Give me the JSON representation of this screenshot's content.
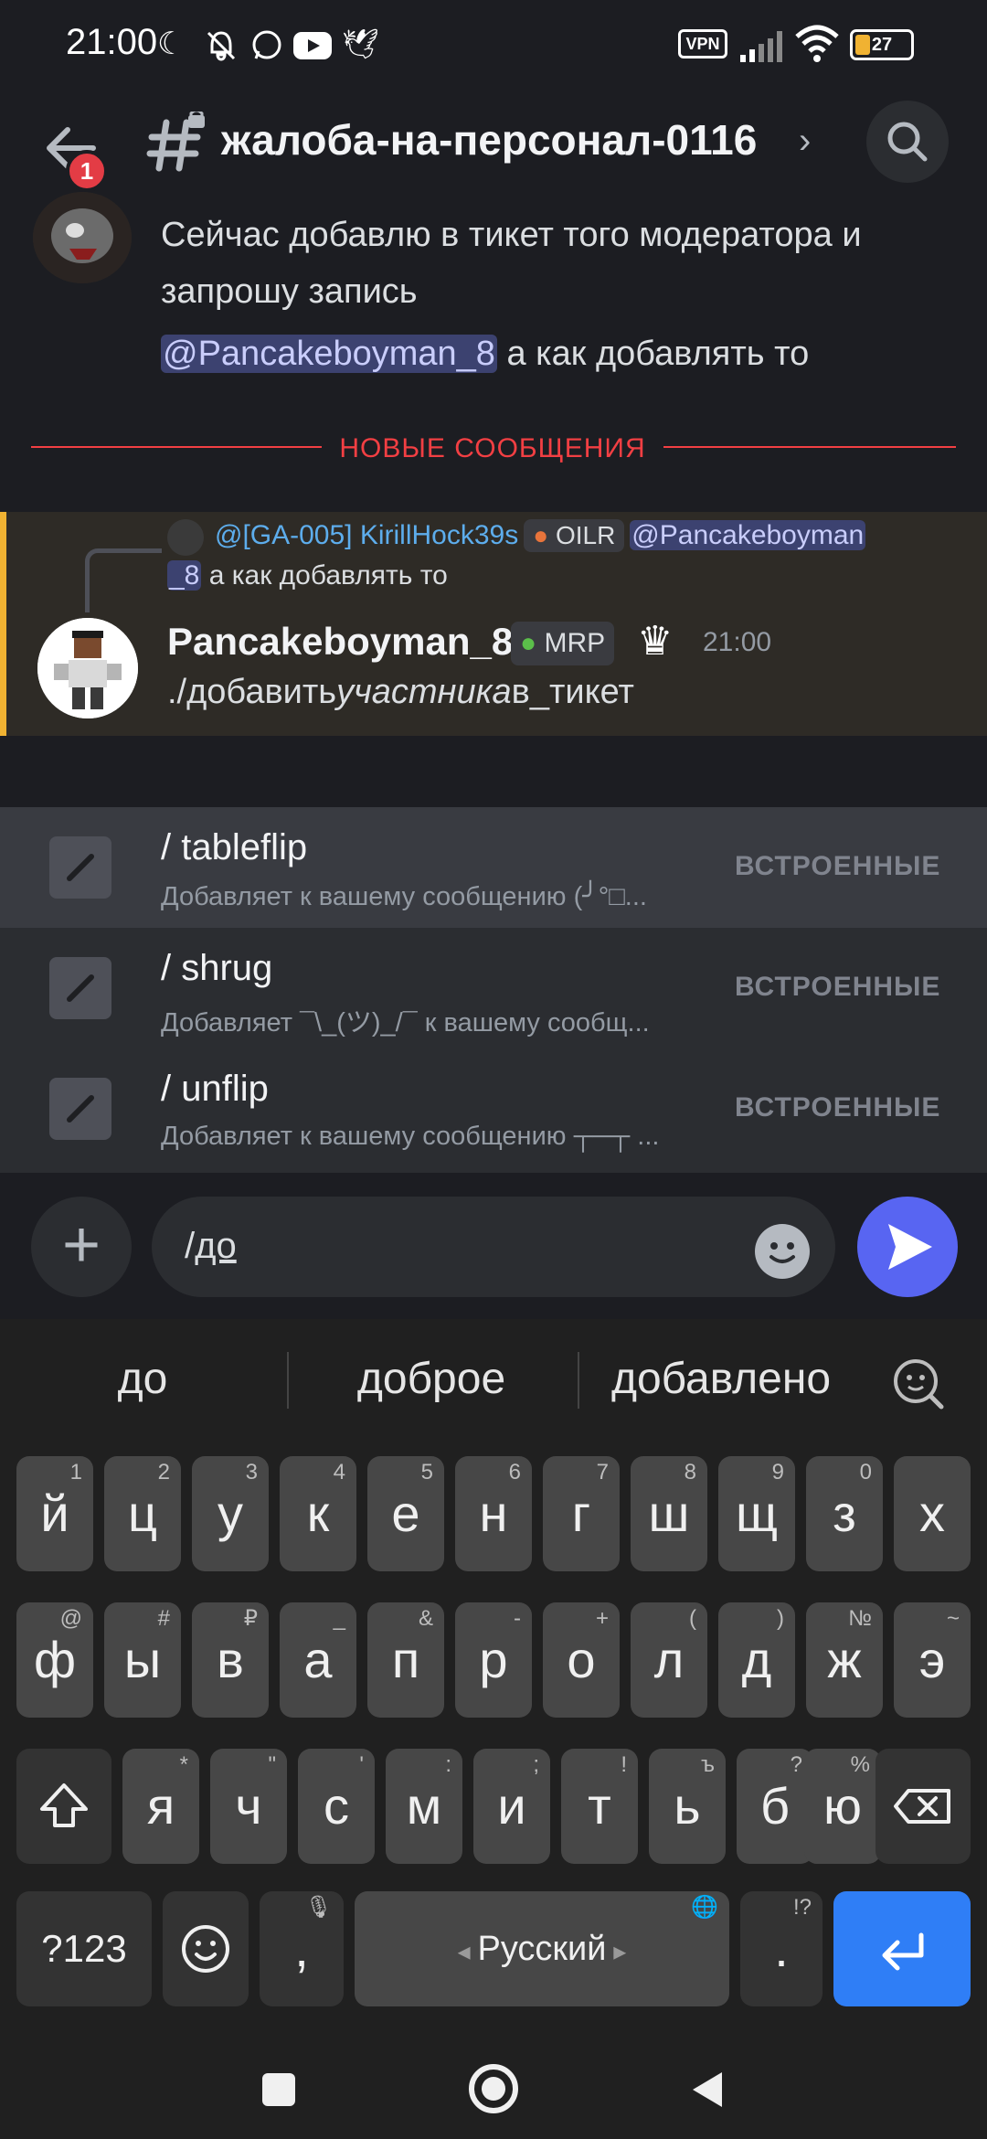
{
  "status_bar": {
    "time": "21:00",
    "vpn_label": "VPN",
    "battery": "27"
  },
  "header": {
    "unread_badge": "1",
    "channel_name": "жалоба-на-персонал-0116"
  },
  "messages": {
    "prev_line1": "Сейчас добавлю в тикет того модератора и",
    "prev_line2": "запрошу запись",
    "prev_mention": "@Pancakeboyman_8",
    "prev_line3_rest": " а как добавлять то",
    "new_messages_label": "НОВЫЕ СООБЩЕНИЯ",
    "reply_author": "@[GA-005] KirillHock39s",
    "reply_role": "OILR",
    "reply_mention_part1": "@Pancakeboyman",
    "reply_mention_part2": "_8",
    "reply_text": " а как добавлять то",
    "author": "Pancakeboyman_8",
    "author_role": "MRP",
    "timestamp": "21:00",
    "body_prefix": "./добавить",
    "body_italic": "участника",
    "body_suffix": "в_тикет"
  },
  "commands": [
    {
      "name": "/ tableflip",
      "description": "Добавляет к вашему сообщению (╯°□...",
      "source": "ВСТРОЕННЫЕ"
    },
    {
      "name": "/ shrug",
      "description": "Добавляет ¯\\_(ツ)_/¯ к вашему сообщ...",
      "source": "ВСТРОЕННЫЕ"
    },
    {
      "name": "/ unflip",
      "description": "Добавляет к вашему сообщению ┬─┬ ...",
      "source": "ВСТРОЕННЫЕ"
    }
  ],
  "composer": {
    "slash": "/",
    "typed": "до"
  },
  "keyboard": {
    "suggestions": [
      "до",
      "доброе",
      "добавлено"
    ],
    "row1": [
      {
        "k": "й",
        "h": "1"
      },
      {
        "k": "ц",
        "h": "2"
      },
      {
        "k": "у",
        "h": "3"
      },
      {
        "k": "к",
        "h": "4"
      },
      {
        "k": "е",
        "h": "5"
      },
      {
        "k": "н",
        "h": "6"
      },
      {
        "k": "г",
        "h": "7"
      },
      {
        "k": "ш",
        "h": "8"
      },
      {
        "k": "щ",
        "h": "9"
      },
      {
        "k": "з",
        "h": "0"
      },
      {
        "k": "х",
        "h": ""
      }
    ],
    "row2": [
      {
        "k": "ф",
        "h": "@"
      },
      {
        "k": "ы",
        "h": "#"
      },
      {
        "k": "в",
        "h": "₽"
      },
      {
        "k": "а",
        "h": "_"
      },
      {
        "k": "п",
        "h": "&"
      },
      {
        "k": "р",
        "h": "-"
      },
      {
        "k": "о",
        "h": "+"
      },
      {
        "k": "л",
        "h": "("
      },
      {
        "k": "д",
        "h": ")"
      },
      {
        "k": "ж",
        "h": "№"
      },
      {
        "k": "э",
        "h": "~"
      }
    ],
    "row3": [
      {
        "k": "я",
        "h": "*"
      },
      {
        "k": "ч",
        "h": "\""
      },
      {
        "k": "с",
        "h": "'"
      },
      {
        "k": "м",
        "h": ":"
      },
      {
        "k": "и",
        "h": ";"
      },
      {
        "k": "т",
        "h": "!"
      },
      {
        "k": "ь",
        "h": "ъ"
      },
      {
        "k": "б",
        "h": "?"
      },
      {
        "k": "ю",
        "h": "%"
      }
    ],
    "numbers_key": "?123",
    "comma_key": ",",
    "space_label": "Русский",
    "period_key": ".",
    "period_hint": "!?"
  }
}
